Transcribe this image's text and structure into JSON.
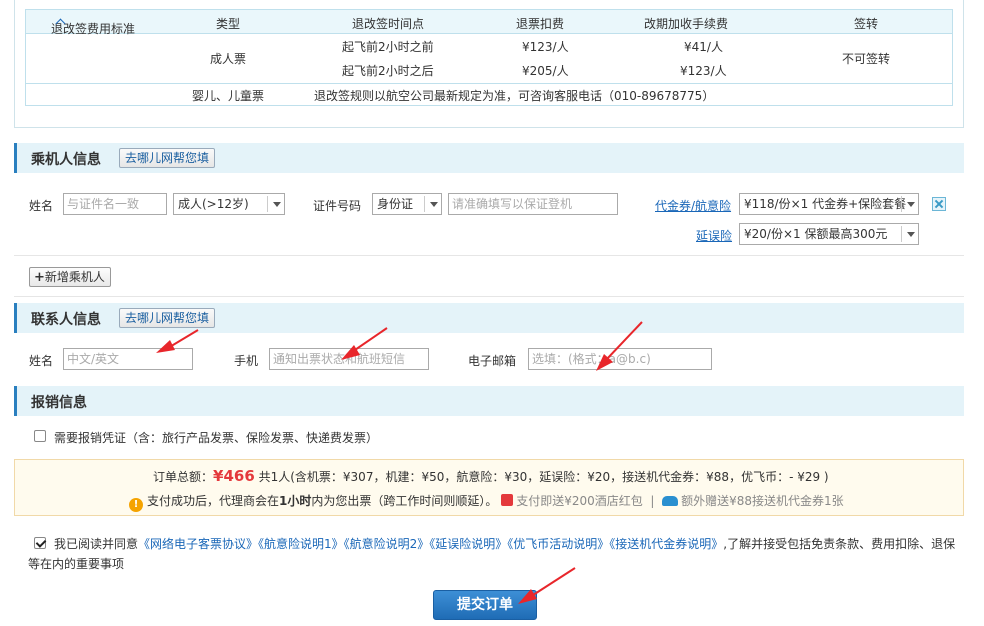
{
  "refund": {
    "toggle_label": "退改签费用标准",
    "columns": [
      "类型",
      "退改签时间点",
      "退票扣费",
      "改期加收手续费",
      "签转"
    ],
    "adult_type": "成人票",
    "rows": [
      {
        "time": "起飞前2小时之前",
        "refund": "¥123/人",
        "change": "¥41/人"
      },
      {
        "time": "起飞前2小时之后",
        "refund": "¥205/人",
        "change": "¥123/人"
      }
    ],
    "transfer": "不可签转",
    "child_type": "婴儿、儿童票",
    "child_note": "退改签规则以航空公司最新规定为准，可咨询客服电话（010-89678775）"
  },
  "passenger": {
    "title": "乘机人信息",
    "help_label": "去哪儿网帮您填",
    "name_label": "姓名",
    "name_placeholder": "与证件名一致",
    "type_value": "成人(>12岁)",
    "id_label": "证件号码",
    "id_type_value": "身份证",
    "id_placeholder": "请准确填写以保证登机",
    "voucher_link": "代金券/航意险",
    "voucher_value": "¥118/份×1 代金券+保险套餐",
    "delay_link": "延误险",
    "delay_value": "¥20/份×1 保额最高300元",
    "add_label": "新增乘机人"
  },
  "contact": {
    "title": "联系人信息",
    "help_label": "去哪儿网帮您填",
    "name_label": "姓名",
    "name_placeholder": "中文/英文",
    "phone_label": "手机",
    "phone_placeholder": "通知出票状态和航班短信",
    "email_label": "电子邮箱",
    "email_placeholder": "选填：(格式：a@b.c)"
  },
  "invoice": {
    "title": "报销信息",
    "checkbox_label": "需要报销凭证（含：旅行产品发票、保险发票、快递费发票）"
  },
  "summary": {
    "total_label": "订单总额：",
    "total_value": "¥466",
    "breakdown": "共1人(含机票：¥307，机建：¥50，航意险：¥30，延误险：¥20，接送机代金券：¥88，优飞币：- ¥29 )",
    "notice_prefix": "支付成功后，代理商会在",
    "notice_bold": "1小时",
    "notice_suffix": "内为您出票（跨工作时间则顺延）。",
    "gift_text": "支付即送¥200酒店红包",
    "separator": "|",
    "car_text": "额外赠送¥88接送机代金券1张"
  },
  "agreement": {
    "prefix": "我已阅读并同意",
    "docs": "《网络电子客票协议》《航意险说明1》《航意险说明2》《延误险说明》《优飞币活动说明》《接送机代金券说明》",
    "suffix": ",了解并接受包括免责条款、费用扣除、退保等在内的重要事项"
  },
  "submit_label": "提交订单",
  "colors": {
    "accent": "#1f6cb5",
    "price": "#e4393c",
    "arrow": "#e8262b"
  }
}
